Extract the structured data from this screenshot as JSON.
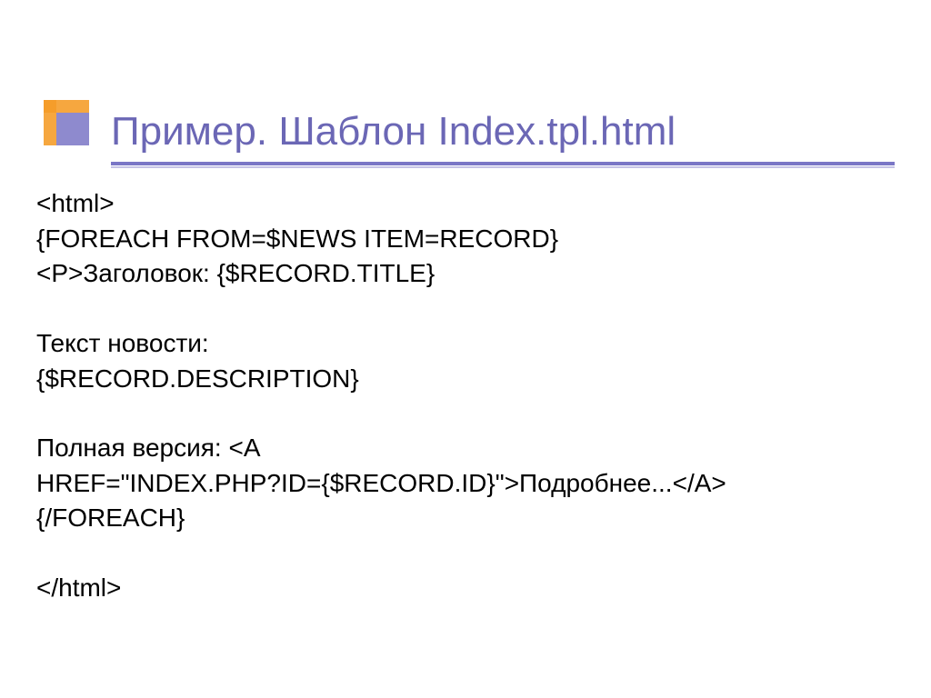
{
  "title": "Пример. Шаблон Index.tpl.html",
  "lines": {
    "l1": "<html>",
    "l2": "{FOREACH FROM=$NEWS ITEM=RECORD}",
    "l3": "<P>Заголовок: {$RECORD.TITLE}",
    "l4": "Текст новости:",
    "l5": " {$RECORD.DESCRIPTION}",
    "l6": "Полная версия: <A",
    "l7": "HREF=\"INDEX.PHP?ID={$RECORD.ID}\">Подробнее...</A>",
    "l8": "{/FOREACH}",
    "l9": "</html>"
  }
}
